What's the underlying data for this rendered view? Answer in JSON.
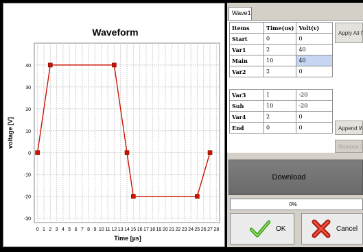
{
  "chart_data": {
    "type": "line",
    "title": "Waveform",
    "xlabel": "Time [µs]",
    "ylabel": "voltage [V]",
    "xlim": [
      -0.5,
      28.5
    ],
    "ylim": [
      -32,
      50
    ],
    "x_ticks": [
      0,
      1,
      2,
      3,
      4,
      5,
      6,
      7,
      8,
      9,
      10,
      11,
      12,
      13,
      14,
      15,
      16,
      17,
      18,
      19,
      20,
      21,
      22,
      23,
      24,
      25,
      26,
      27,
      28
    ],
    "y_ticks": [
      -30,
      -20,
      -10,
      0,
      10,
      20,
      30,
      40
    ],
    "grid": true,
    "series": [
      {
        "color": "#cc1100",
        "x": [
          0,
          2,
          12,
          14,
          15,
          25,
          27
        ],
        "y": [
          0,
          40,
          40,
          0,
          -20,
          -20,
          0
        ]
      }
    ]
  },
  "tab": {
    "label": "Wave1"
  },
  "table": {
    "headers": [
      "Items",
      "Time(us)",
      "Volt(v)"
    ],
    "rows_top": [
      {
        "item": "Start",
        "time": "0",
        "volt": "0"
      },
      {
        "item": "Var1",
        "time": "2",
        "volt": "40"
      },
      {
        "item": "Main",
        "time": "10",
        "volt": "40"
      },
      {
        "item": "Var2",
        "time": "2",
        "volt": "0"
      }
    ],
    "rows_bottom": [
      {
        "item": "Var3",
        "time": "1",
        "volt": "-20"
      },
      {
        "item": "Sub",
        "time": "10",
        "volt": "-20"
      },
      {
        "item": "Var4",
        "time": "2",
        "volt": "0"
      },
      {
        "item": "End",
        "time": "0",
        "volt": "0"
      }
    ]
  },
  "buttons": {
    "apply": "Apply All N",
    "append": "Append W",
    "remove": "Remove V",
    "download": "Download",
    "ok": "OK",
    "cancel": "Cancel"
  },
  "progress": {
    "text": "0%",
    "value": 0
  },
  "icons": {
    "ok": "checkmark-icon",
    "cancel": "x-icon"
  }
}
